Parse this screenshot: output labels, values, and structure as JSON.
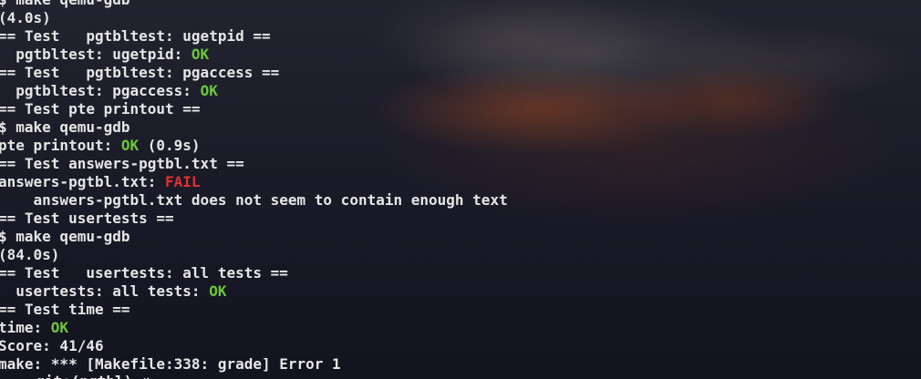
{
  "terminal": {
    "lines": [
      {
        "pre": "$ make qemu-gdb",
        "status": "",
        "post": ""
      },
      {
        "pre": "(4.0s)",
        "status": "",
        "post": ""
      },
      {
        "pre": "== Test   pgtbltest: ugetpid ==",
        "status": "",
        "post": ""
      },
      {
        "pre": "  pgtbltest: ugetpid: ",
        "status": "OK",
        "post": ""
      },
      {
        "pre": "== Test   pgtbltest: pgaccess ==",
        "status": "",
        "post": ""
      },
      {
        "pre": "  pgtbltest: pgaccess: ",
        "status": "OK",
        "post": ""
      },
      {
        "pre": "== Test pte printout ==",
        "status": "",
        "post": ""
      },
      {
        "pre": "$ make qemu-gdb",
        "status": "",
        "post": ""
      },
      {
        "pre": "pte printout: ",
        "status": "OK",
        "post": " (0.9s)"
      },
      {
        "pre": "== Test answers-pgtbl.txt ==",
        "status": "",
        "post": ""
      },
      {
        "pre": "answers-pgtbl.txt: ",
        "status": "FAIL",
        "post": ""
      },
      {
        "pre": "    answers-pgtbl.txt does not seem to contain enough text",
        "status": "",
        "post": ""
      },
      {
        "pre": "== Test usertests ==",
        "status": "",
        "post": ""
      },
      {
        "pre": "$ make qemu-gdb",
        "status": "",
        "post": ""
      },
      {
        "pre": "(84.0s)",
        "status": "",
        "post": ""
      },
      {
        "pre": "== Test   usertests: all tests ==",
        "status": "",
        "post": ""
      },
      {
        "pre": "  usertests: all tests: ",
        "status": "OK",
        "post": ""
      },
      {
        "pre": "== Test time ==",
        "status": "",
        "post": ""
      },
      {
        "pre": "time: ",
        "status": "OK",
        "post": ""
      },
      {
        "pre": "Score: 41/46",
        "status": "",
        "post": ""
      },
      {
        "pre": "make: *** [Makefile:338: grade] Error 1",
        "status": "",
        "post": ""
      }
    ],
    "cut_off_line": "~ git:(pgtbl) ✗"
  },
  "colors": {
    "text": "#e6e6e6",
    "ok": "#6cc63a",
    "fail": "#e2322f"
  }
}
